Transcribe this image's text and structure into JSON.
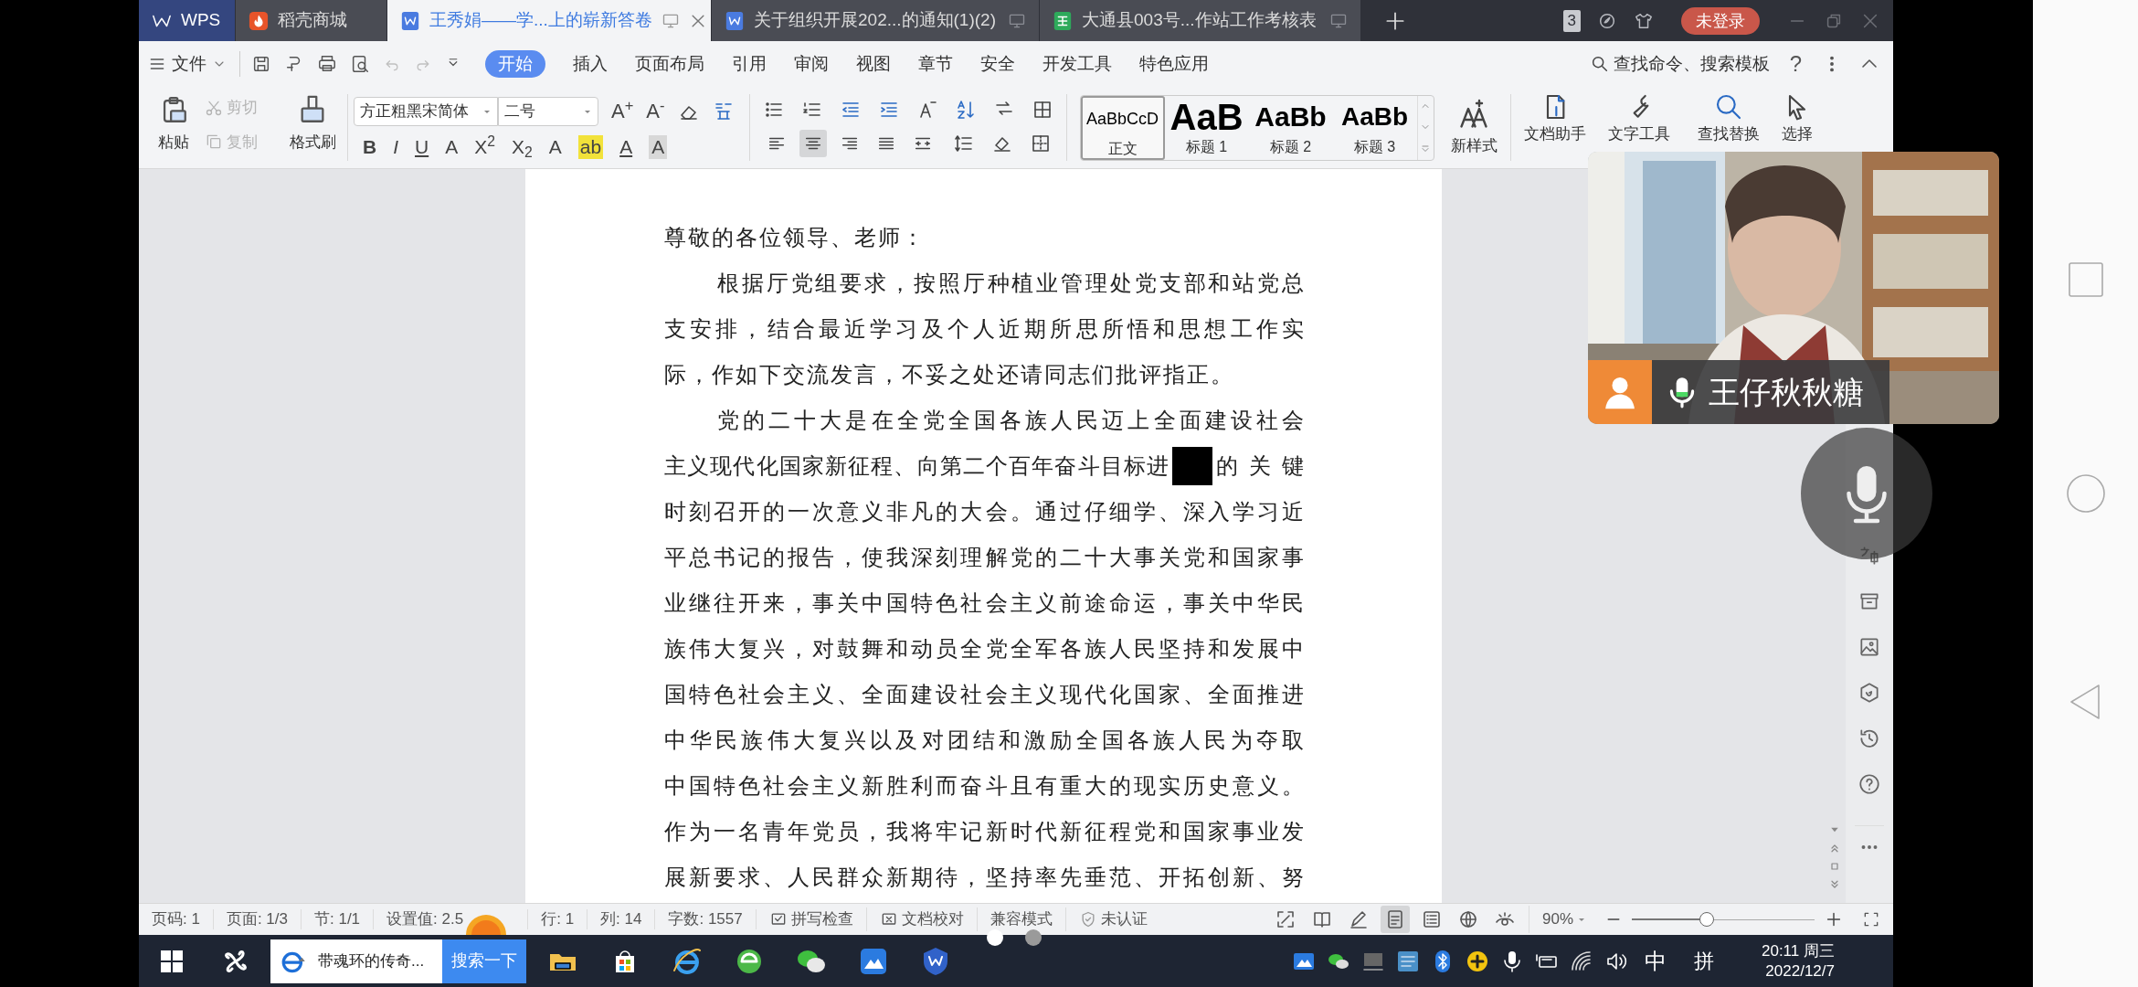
{
  "tabs": [
    {
      "label": "WPS",
      "selected": false
    },
    {
      "label": "稻壳商城",
      "selected": false
    },
    {
      "label": "王秀娟——学...上的崭新答卷",
      "selected": true
    },
    {
      "label": "关于组织开展202...的通知(1)(2)",
      "selected": false
    },
    {
      "label": "大通县003号...作站工作考核表",
      "selected": false
    }
  ],
  "tab_bar": {
    "window_count": "3",
    "login": "未登录"
  },
  "menu": {
    "file": "文件",
    "items": [
      {
        "label": "开始",
        "selected": true
      },
      {
        "label": "插入",
        "selected": false
      },
      {
        "label": "页面布局",
        "selected": false
      },
      {
        "label": "引用",
        "selected": false
      },
      {
        "label": "审阅",
        "selected": false
      },
      {
        "label": "视图",
        "selected": false
      },
      {
        "label": "章节",
        "selected": false
      },
      {
        "label": "安全",
        "selected": false
      },
      {
        "label": "开发工具",
        "selected": false
      },
      {
        "label": "特色应用",
        "selected": false
      }
    ],
    "search": "查找命令、搜索模板",
    "help": "?"
  },
  "ribbon": {
    "paste": "粘贴",
    "cut": {
      "label": "剪切",
      "disabled": true
    },
    "copy": {
      "label": "复制",
      "disabled": true
    },
    "format_painter": "格式刷",
    "font": "方正粗黑宋简体",
    "size": "二号",
    "size_buttons": [
      "A$^{+}$",
      "A$^{-}$"
    ],
    "format_buttons": [
      "B",
      "I",
      "U",
      "A",
      "X$^{2}$",
      "X$_{2}$",
      "A",
      "ab",
      "A",
      "A"
    ],
    "paragraph_align": [
      {
        "selected": false
      },
      {
        "selected": true
      },
      {
        "selected": false
      },
      {
        "selected": false
      },
      {
        "selected": false
      }
    ],
    "styles": [
      {
        "sample": "AaBbCcD",
        "label": "正文",
        "selected": true
      },
      {
        "sample": "AaB",
        "label": "标题 1",
        "selected": false
      },
      {
        "sample": "AaBb",
        "label": "标题 2",
        "selected": false
      },
      {
        "sample": "AaBb",
        "label": "标题 3",
        "selected": false
      }
    ],
    "new_style": "新样式",
    "doc_helper": "文档助手",
    "text_tools": "文字工具",
    "find_replace": "查找替换",
    "select": "选择"
  },
  "document": {
    "lines": [
      {
        "kind": "text",
        "indent": false,
        "end": true,
        "text": "尊敬的各位领导、老师："
      },
      {
        "kind": "text",
        "indent": true,
        "end": false,
        "text": "根据厅党组要求，按照厅种植业管理处党支部和站党总"
      },
      {
        "kind": "text",
        "indent": false,
        "end": false,
        "text": "支安排，结合最近学习及个人近期所思所悟和思想工作实"
      },
      {
        "kind": "text",
        "indent": false,
        "end": true,
        "text": "际，作如下交流发言，不妥之处还请同志们批评指正。"
      },
      {
        "kind": "text",
        "indent": true,
        "end": false,
        "text": "党的二十大是在全党全国各族人民迈上全面建设社会"
      },
      {
        "kind": "redacted",
        "indent": false,
        "end": false,
        "parts": [
          "主义现代化国家新征程、向第二个百年奋斗目标进",
          "的关键"
        ]
      },
      {
        "kind": "text",
        "indent": false,
        "end": false,
        "text": "时刻召开的一次意义非凡的大会。通过仔细学、深入学习近"
      },
      {
        "kind": "text",
        "indent": false,
        "end": false,
        "text": "平总书记的报告，使我深刻理解党的二十大事关党和国家事"
      },
      {
        "kind": "text",
        "indent": false,
        "end": false,
        "text": "业继往开来，事关中国特色社会主义前途命运，事关中华民"
      },
      {
        "kind": "text",
        "indent": false,
        "end": false,
        "text": "族伟大复兴，对鼓舞和动员全党全军各族人民坚持和发展中"
      },
      {
        "kind": "text",
        "indent": false,
        "end": false,
        "text": "国特色社会主义、全面建设社会主义现代化国家、全面推进"
      },
      {
        "kind": "text",
        "indent": false,
        "end": false,
        "text": "中华民族伟大复兴以及对团结和激励全国各族人民为夺取"
      },
      {
        "kind": "text",
        "indent": false,
        "end": false,
        "text": "中国特色社会主义新胜利而奋斗且有重大的现实历史意义。"
      },
      {
        "kind": "text",
        "indent": false,
        "end": false,
        "text": "作为一名青年党员，我将牢记新时代新征程党和国家事业发"
      },
      {
        "kind": "text",
        "indent": false,
        "end": false,
        "text": "展新要求、人民群众新期待，坚持率先垂范、开拓创新、努"
      }
    ]
  },
  "video": {
    "kind": "picture",
    "name": "王仔秋秋糖"
  },
  "status_bar": {
    "items": [
      "页码: 1",
      "页面: 1/3",
      "节: 1/1",
      "设置值: 2.5",
      "行: 1",
      "列: 14",
      "字数: 1557"
    ],
    "spell_check": "拼写检查",
    "proofread": "文档校对",
    "compat": "兼容模式",
    "cert": "未认证",
    "view_modes": [
      {
        "selected": false
      },
      {
        "selected": false
      },
      {
        "selected": false
      },
      {
        "selected": true
      },
      {
        "selected": false
      },
      {
        "selected": false
      },
      {
        "selected": false
      }
    ],
    "zoom": "90%",
    "zoom_slider": {
      "level": 0.41
    }
  },
  "pager": [
    {
      "selected": true
    },
    {
      "selected": false
    }
  ],
  "taskbar": {
    "search_text": "带魂环的传奇...",
    "search_button": "搜索一下",
    "ime": "中",
    "ime_mode": "拼",
    "time": "20:11 周三",
    "date": "2022/12/7"
  }
}
